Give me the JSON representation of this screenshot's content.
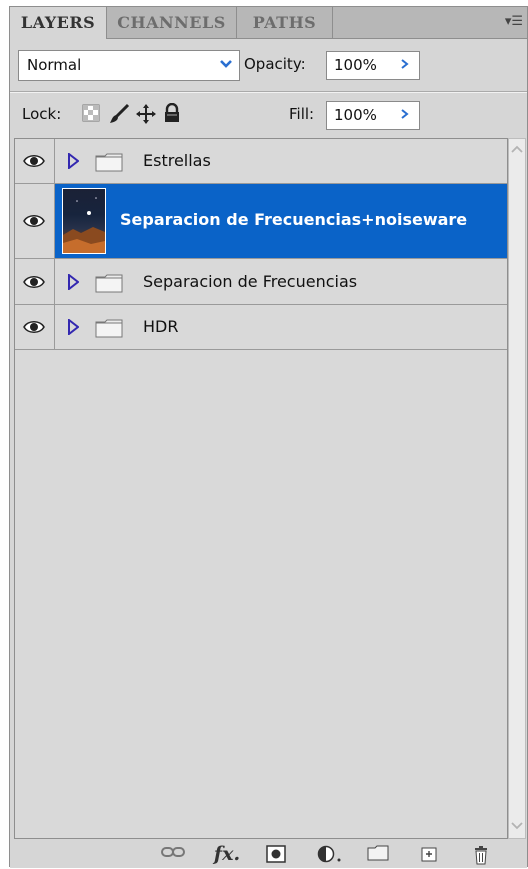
{
  "tabs": [
    {
      "label": "LAYERS",
      "active": true
    },
    {
      "label": "CHANNELS",
      "active": false
    },
    {
      "label": "PATHS",
      "active": false
    }
  ],
  "panel_menu_icon": "panel-menu-icon",
  "blend_mode": {
    "value": "Normal"
  },
  "opacity": {
    "label": "Opacity:",
    "value": "100%"
  },
  "lock": {
    "label": "Lock:",
    "icons": [
      "lock-transparency-icon",
      "lock-paint-icon",
      "lock-position-icon",
      "lock-all-icon"
    ]
  },
  "fill": {
    "label": "Fill:",
    "value": "100%"
  },
  "layers": [
    {
      "name": "Estrellas",
      "type": "group",
      "visible": true,
      "selected": false
    },
    {
      "name": "Separacion de Frecuencias+noiseware",
      "type": "layer",
      "visible": true,
      "selected": true
    },
    {
      "name": "Separacion de Frecuencias",
      "type": "group",
      "visible": true,
      "selected": false
    },
    {
      "name": "HDR",
      "type": "group",
      "visible": true,
      "selected": false
    }
  ],
  "toolbar": {
    "icons": [
      "link-layers-icon",
      "fx-icon",
      "layer-mask-icon",
      "adjustment-layer-icon",
      "new-group-icon",
      "new-layer-icon",
      "trash-icon"
    ],
    "fx_text": "fx"
  },
  "colors": {
    "selection": "#0a63c8",
    "accent_arrow": "#2a6fd1"
  }
}
